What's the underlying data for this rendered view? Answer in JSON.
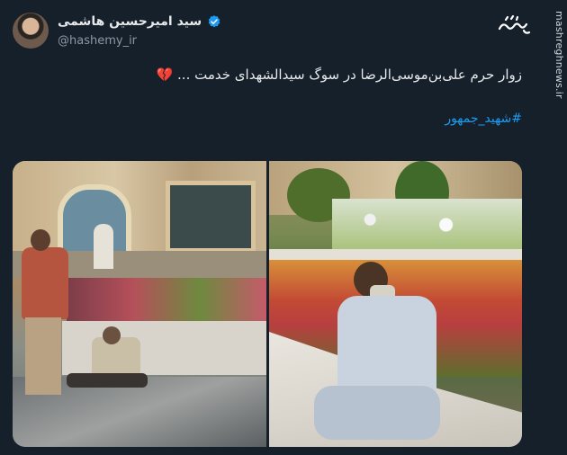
{
  "author": {
    "name": "سید امیرحسین هاشمی",
    "handle": "@hashemy_ir"
  },
  "watermark": {
    "side_text": "mashreghnews.ir"
  },
  "tweet": {
    "text": "زوار حرم علی‌بن‌موسی‌الرضا در سوگ سیدالشهدای خدمت ...",
    "emoji": "💔",
    "hashtag": "#شهید_جمهور"
  },
  "media": {
    "image_count": 2
  },
  "colors": {
    "background": "#15202b",
    "link": "#1d9bf0",
    "verified": "#1d9bf0"
  }
}
